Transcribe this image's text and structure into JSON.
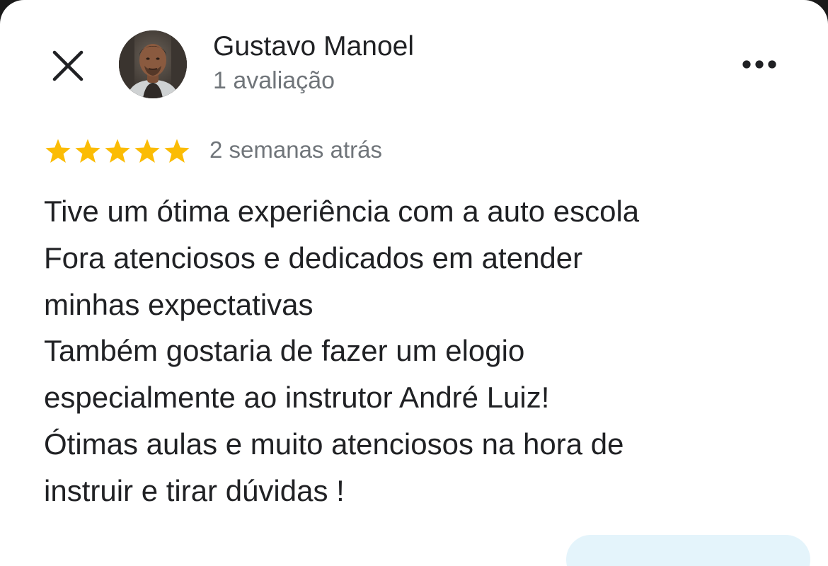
{
  "review": {
    "author": "Gustavo Manoel",
    "author_meta": "1 avaliação",
    "rating": 5,
    "max_rating": 5,
    "time": "2 semanas atrás",
    "text_lines": [
      "Tive um ótima experiência com a auto escola",
      "Fora atenciosos e dedicados em atender",
      "minhas expectativas",
      "Também gostaria de fazer um elogio",
      "especialmente ao instrutor André Luiz!",
      "Ótimas aulas e muito atenciosos na hora de",
      "instruir e tirar dúvidas !"
    ]
  },
  "icons": {
    "close": "close-icon",
    "more": "more-horizontal-icon",
    "star": "star-icon"
  },
  "colors": {
    "star": "#fbbc04",
    "reply_chip": "#e4f4fb"
  }
}
